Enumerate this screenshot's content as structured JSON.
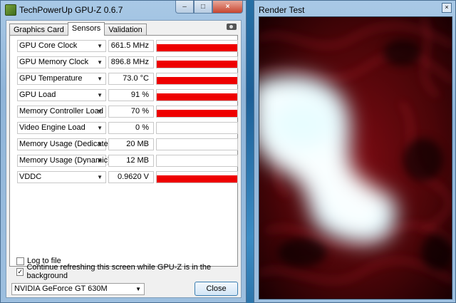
{
  "gpuz": {
    "title": "TechPowerUp GPU-Z 0.6.7",
    "tabs": [
      "Graphics Card",
      "Sensors",
      "Validation"
    ],
    "active_tab": "Sensors",
    "sensors": [
      {
        "name": "GPU Core Clock",
        "value": "661.5 MHz",
        "level": 1.0
      },
      {
        "name": "GPU Memory Clock",
        "value": "896.8 MHz",
        "level": 1.0
      },
      {
        "name": "GPU Temperature",
        "value": "73.0 °C",
        "level": 1.0
      },
      {
        "name": "GPU Load",
        "value": "91 %",
        "level": 1.0
      },
      {
        "name": "Memory Controller Load",
        "value": "70 %",
        "level": 1.0
      },
      {
        "name": "Video Engine Load",
        "value": "0 %",
        "level": 0.0
      },
      {
        "name": "Memory Usage (Dedicated)",
        "value": "20 MB",
        "level": 0.0
      },
      {
        "name": "Memory Usage (Dynamic)",
        "value": "12 MB",
        "level": 0.0
      },
      {
        "name": "VDDC",
        "value": "0.9620 V",
        "level": 1.0
      }
    ],
    "log_to_file": "Log to file",
    "log_to_file_checked": false,
    "continue_refresh": "Continue refreshing this screen while GPU-Z is in the background",
    "continue_refresh_checked": true,
    "gpu_selected": "NVIDIA GeForce GT 630M",
    "close_label": "Close",
    "bar_color": "#ee0000"
  },
  "render": {
    "title": "Render Test",
    "close_symbol": "×"
  },
  "icons": {
    "minimize": "–",
    "maximize": "□",
    "close": "×",
    "dropdown": "▼",
    "check": "✓"
  }
}
